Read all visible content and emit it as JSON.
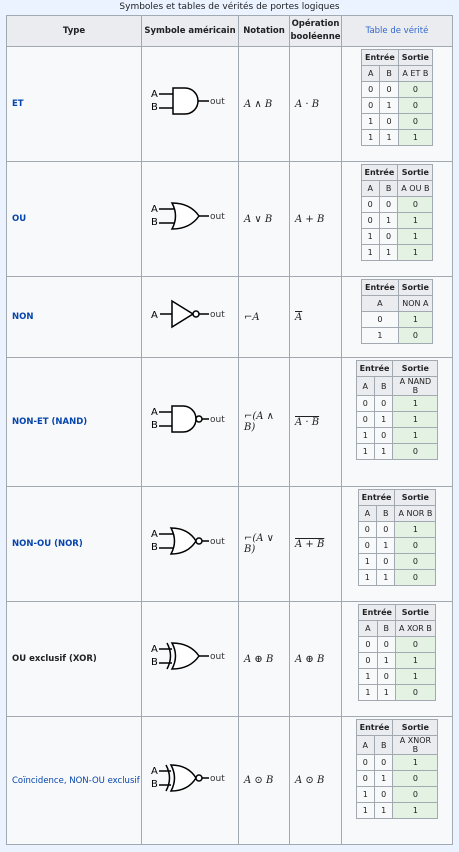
{
  "caption": "Symboles et tables de vérités de portes logiques",
  "headers": {
    "type": "Type",
    "symbol": "Symbole américain",
    "notation": "Notation",
    "op_line1": "Opération",
    "op_line2": "booléenne",
    "truth": "Table de vérité"
  },
  "tt_labels": {
    "input": "Entrée",
    "output": "Sortie",
    "a": "A",
    "b": "B"
  },
  "gate_labels": {
    "a": "A",
    "b": "B",
    "out": "out"
  },
  "rows": [
    {
      "type": "ET",
      "notation": "A ∧ B",
      "operation": "A · B",
      "out_header": "A ET B",
      "truth": [
        [
          "0",
          "0",
          "0"
        ],
        [
          "0",
          "1",
          "0"
        ],
        [
          "1",
          "0",
          "0"
        ],
        [
          "1",
          "1",
          "1"
        ]
      ]
    },
    {
      "type": "OU",
      "notation": "A ∨ B",
      "operation": "A + B",
      "out_header": "A OU B",
      "truth": [
        [
          "0",
          "0",
          "0"
        ],
        [
          "0",
          "1",
          "1"
        ],
        [
          "1",
          "0",
          "1"
        ],
        [
          "1",
          "1",
          "1"
        ]
      ]
    },
    {
      "type": "NON",
      "notation": "⌐A",
      "operation": "A",
      "out_header": "NON A",
      "truth": [
        [
          "0",
          "1"
        ],
        [
          "1",
          "0"
        ]
      ]
    },
    {
      "type": "NON-ET (NAND)",
      "notation": "⌐(A ∧ B)",
      "operation": "A · B",
      "out_header": "A NAND B",
      "truth": [
        [
          "0",
          "0",
          "1"
        ],
        [
          "0",
          "1",
          "1"
        ],
        [
          "1",
          "0",
          "1"
        ],
        [
          "1",
          "1",
          "0"
        ]
      ]
    },
    {
      "type": "NON-OU (NOR)",
      "notation": "⌐(A ∨ B)",
      "operation": "A + B",
      "out_header": "A NOR B",
      "truth": [
        [
          "0",
          "0",
          "1"
        ],
        [
          "0",
          "1",
          "0"
        ],
        [
          "1",
          "0",
          "0"
        ],
        [
          "1",
          "1",
          "0"
        ]
      ]
    },
    {
      "type": "OU exclusif (XOR)",
      "notation": "A ⊕ B",
      "operation": "A ⊕ B",
      "out_header": "A XOR B",
      "truth": [
        [
          "0",
          "0",
          "0"
        ],
        [
          "0",
          "1",
          "1"
        ],
        [
          "1",
          "0",
          "1"
        ],
        [
          "1",
          "1",
          "0"
        ]
      ]
    },
    {
      "type": "Coïncidence, NON-OU exclusif",
      "notation": "A ⊙ B",
      "operation": "A ⊙ B",
      "out_header": "A XNOR B",
      "truth": [
        [
          "0",
          "0",
          "1"
        ],
        [
          "0",
          "1",
          "0"
        ],
        [
          "1",
          "0",
          "0"
        ],
        [
          "1",
          "1",
          "1"
        ]
      ]
    }
  ]
}
